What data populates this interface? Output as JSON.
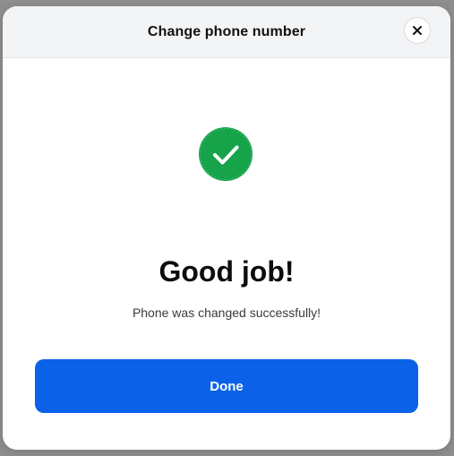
{
  "modal": {
    "title": "Change phone number",
    "close_icon": "close-icon",
    "success_icon": "check-circle-icon",
    "headline": "Good job!",
    "message": "Phone was changed successfully!",
    "done_label": "Done"
  },
  "colors": {
    "accent": "#0b62e8",
    "success": "#16a34a",
    "header_bg": "#f3f4f6"
  }
}
